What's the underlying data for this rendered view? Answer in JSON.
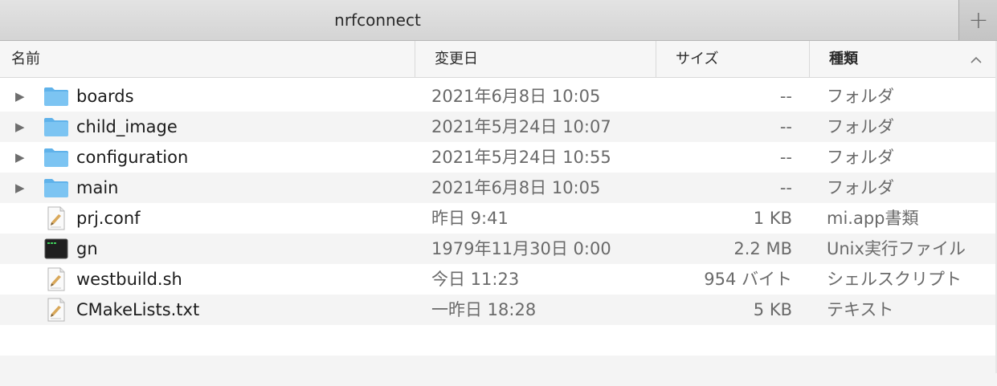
{
  "window": {
    "tab_title": "nrfconnect",
    "add_tab_icon": "plus-icon",
    "add_tab_glyph": "+"
  },
  "columns": {
    "name": "名前",
    "date": "変更日",
    "size": "サイズ",
    "kind": "種類",
    "sort_indicator": "^"
  },
  "files": [
    {
      "name": "boards",
      "date": "2021年6月8日 10:05",
      "size": "--",
      "kind": "フォルダ",
      "icon": "folder-icon",
      "expandable": true,
      "disclosure": "▶"
    },
    {
      "name": "child_image",
      "date": "2021年5月24日 10:07",
      "size": "--",
      "kind": "フォルダ",
      "icon": "folder-icon",
      "expandable": true,
      "disclosure": "▶"
    },
    {
      "name": "configuration",
      "date": "2021年5月24日 10:55",
      "size": "--",
      "kind": "フォルダ",
      "icon": "folder-icon",
      "expandable": true,
      "disclosure": "▶"
    },
    {
      "name": "main",
      "date": "2021年6月8日 10:05",
      "size": "--",
      "kind": "フォルダ",
      "icon": "folder-icon",
      "expandable": true,
      "disclosure": "▶"
    },
    {
      "name": "prj.conf",
      "date": "昨日 9:41",
      "size": "1 KB",
      "kind": "mi.app書類",
      "icon": "document-icon",
      "expandable": false,
      "disclosure": ""
    },
    {
      "name": "gn",
      "date": "1979年11月30日 0:00",
      "size": "2.2 MB",
      "kind": "Unix実行ファイル",
      "icon": "terminal-exec-icon",
      "expandable": false,
      "disclosure": ""
    },
    {
      "name": "westbuild.sh",
      "date": "今日 11:23",
      "size": "954 バイト",
      "kind": "シェルスクリプト",
      "icon": "document-icon",
      "expandable": false,
      "disclosure": ""
    },
    {
      "name": "CMakeLists.txt",
      "date": "一昨日 18:28",
      "size": "5 KB",
      "kind": "テキスト",
      "icon": "document-icon",
      "expandable": false,
      "disclosure": ""
    }
  ],
  "colors": {
    "folder": "#7cc4f2",
    "folder_tab": "#5fb2ea",
    "row_alt": "#f4f4f4",
    "secondary_text": "#6a6a6a"
  }
}
